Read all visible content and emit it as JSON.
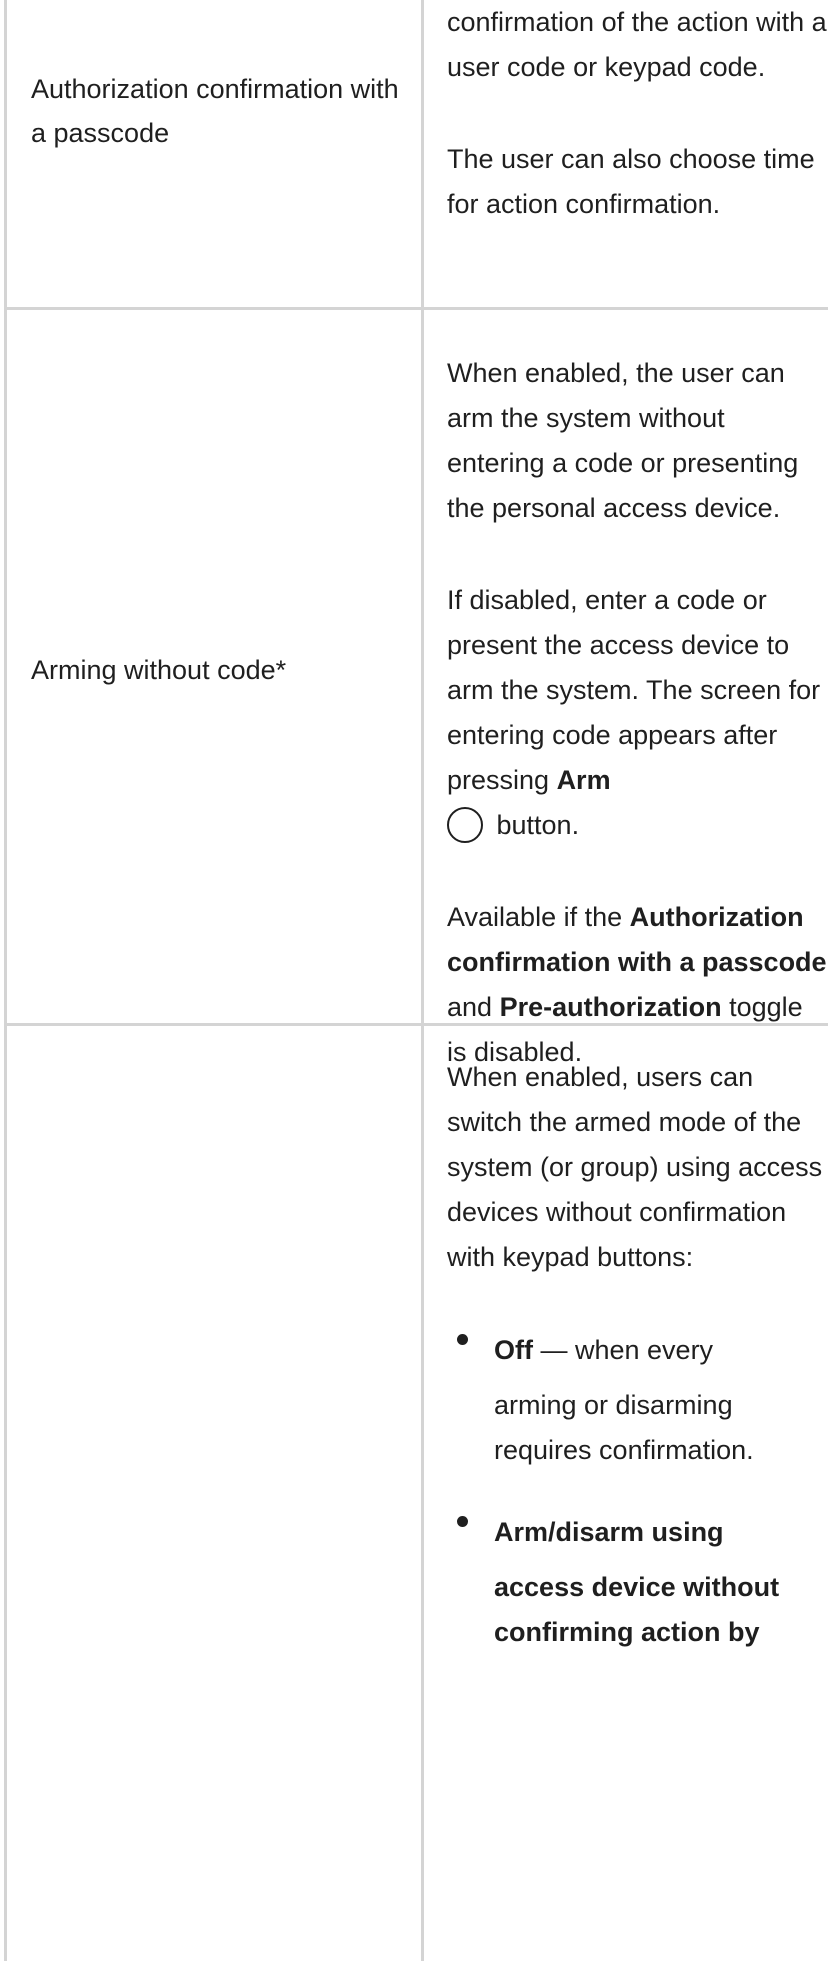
{
  "rows": [
    {
      "label": "Authorization confirmation with a passcode",
      "description": [
        "confirmation of the action with a user code or keypad code.",
        "The user can also choose time for action confirmation."
      ]
    },
    {
      "label": "Arming without code*",
      "p1": "When enabled, the user can arm the system without entering a code or presenting the personal access device.",
      "p2_prefix": "If disabled, enter a code or present the access device to arm the system. The screen for entering code appears after pressing ",
      "p2_bold": "Arm",
      "p2_suffix": " button.",
      "p3_prefix": "Available if the ",
      "p3_bold1": "Authorization confirmation with a passcode",
      "p3_mid": " and ",
      "p3_bold2": "Pre-authorization",
      "p3_suffix": " toggle is disabled."
    },
    {
      "label": "",
      "p1": "When enabled, users can switch the armed mode of the system (or group) using access devices without confirmation with keypad buttons:",
      "options": [
        {
          "bold": "Off",
          "first_rest": " — when every",
          "rest": "arming or disarming requires confirmation."
        },
        {
          "bold": "Arm/disarm using",
          "bold_rest": "access device without confirming action by"
        }
      ]
    }
  ]
}
